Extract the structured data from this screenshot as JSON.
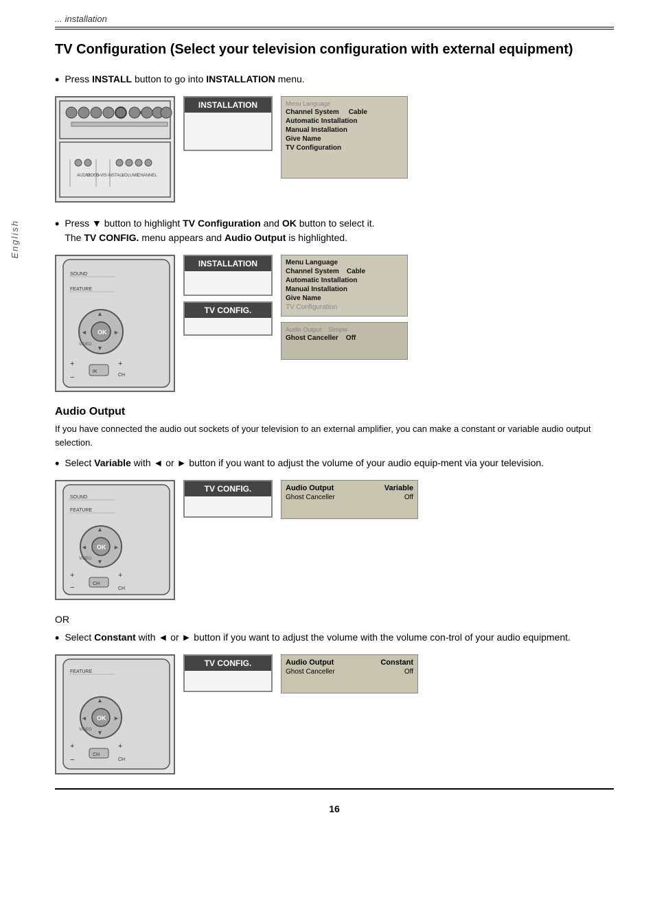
{
  "page": {
    "breadcrumb": "... installation",
    "title": "TV Configuration (Select your television configuration with external equipment)",
    "section1": {
      "bullet1": {
        "prefix": "Press ",
        "keyword1": "INSTALL",
        "middle": " button to go into ",
        "keyword2": "INSTALLATION",
        "suffix": " menu."
      }
    },
    "section2": {
      "bullet1_line1_prefix": "Press ",
      "bullet1_line1_key": "▼",
      "bullet1_line1_mid": " button to highlight ",
      "bullet1_line1_bold": "TV Configuration",
      "bullet1_line1_mid2": " and ",
      "bullet1_line1_bold2": "OK",
      "bullet1_line1_suf": " button to select it.",
      "bullet1_line2_prefix": "The ",
      "bullet1_line2_bold": "TV CONFIG.",
      "bullet1_line2_mid": " menu appears and ",
      "bullet1_line2_bold2": "Audio Output",
      "bullet1_line2_suf": " is highlighted."
    },
    "audio_output_section": {
      "title": "Audio Output",
      "body1": "If you have connected the audio out sockets of your television to an external amplifier, you can make a constant or variable audio output selection.",
      "bullet_variable_prefix": "Select ",
      "bullet_variable_bold": "Variable",
      "bullet_variable_mid": " with ◄ or ► button if you want to adjust the volume of your audio equip-ment via your television.",
      "or_text": "OR",
      "bullet_constant_prefix": "Select ",
      "bullet_constant_bold": "Constant",
      "bullet_constant_mid": " with ◄ or ► button if you want to adjust the volume with the volume con-trol of your  audio equipment."
    },
    "menus": {
      "installation_label": "INSTALLATION",
      "tvconfig_label": "TV CONFIG.",
      "installation_items": [
        "Menu Language",
        "Channel System",
        "Automatic Installation",
        "Manual Installation",
        "Give Name",
        "TV Configuration"
      ],
      "tvconfig_items_variable": [
        {
          "label": "Audio Output",
          "value": "Variable"
        },
        {
          "label": "Ghost Canceller",
          "value": "Off"
        }
      ],
      "tvconfig_items_constant": [
        {
          "label": "Audio Output",
          "value": "Constant"
        },
        {
          "label": "Ghost Canceller",
          "value": "Off"
        }
      ],
      "section1_submenu": [
        "Menu Language",
        "Channel System        Cable",
        "Automatic Installation",
        "Manual Installation",
        "Give Name",
        "TV Configuration"
      ]
    },
    "sidebar_text": "English",
    "page_number": "16"
  }
}
